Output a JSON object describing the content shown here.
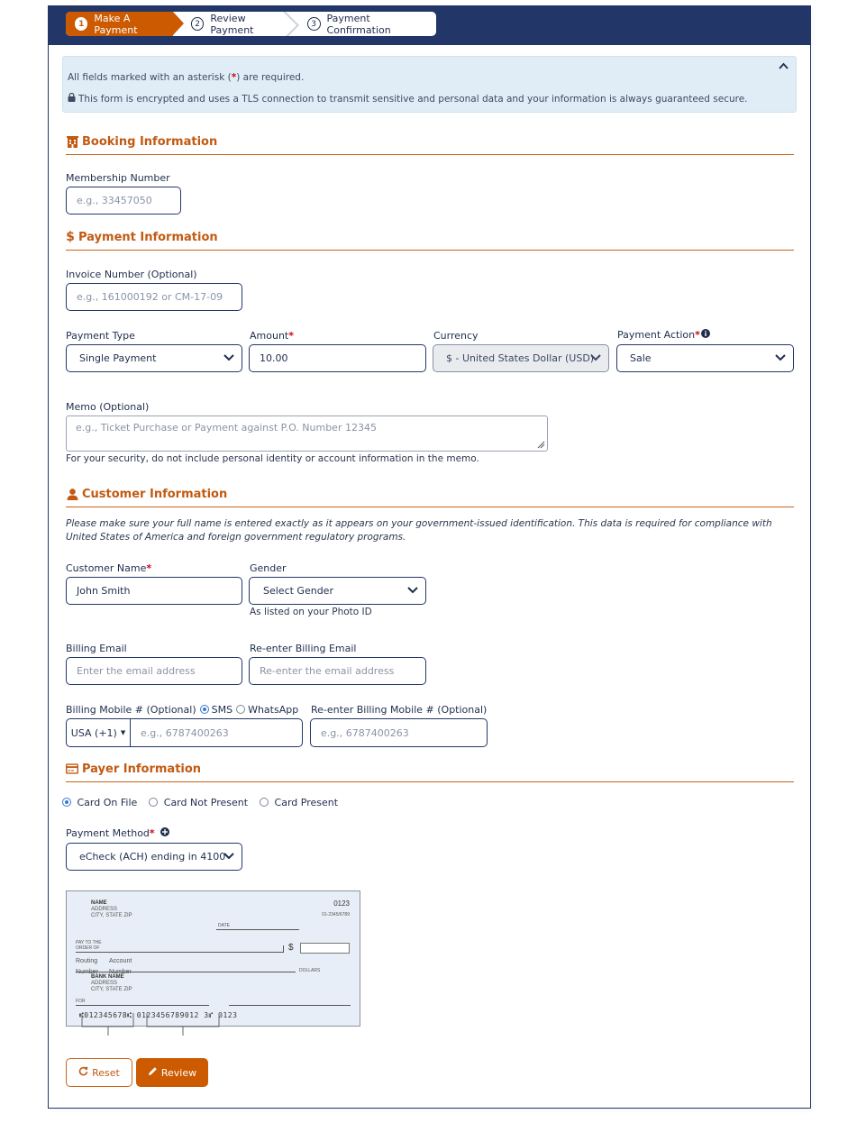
{
  "stepper": {
    "steps": [
      {
        "num": "1",
        "label": "Make A Payment",
        "active": true
      },
      {
        "num": "2",
        "label": "Review Payment",
        "active": false
      },
      {
        "num": "3",
        "label": "Payment Confirmation",
        "active": false
      }
    ]
  },
  "notice": {
    "required_prefix": "All fields marked with an asterisk (",
    "required_star": "*",
    "required_suffix": ") are required.",
    "security_text": "This form is encrypted and uses a TLS connection to transmit sensitive and personal data and your information is always guaranteed secure.",
    "collapse_icon": "chevron-up-icon"
  },
  "booking": {
    "title": "Booking Information",
    "icon": "building-icon",
    "membership_label": "Membership Number",
    "membership_placeholder": "e.g., 33457050"
  },
  "payment": {
    "title": "Payment Information",
    "icon": "dollar-icon",
    "invoice_label": "Invoice Number (Optional)",
    "invoice_placeholder": "e.g., 161000192 or CM-17-09",
    "payment_type_label": "Payment Type",
    "payment_type_value": "Single Payment",
    "amount_label": "Amount",
    "amount_value": "10.00",
    "currency_label": "Currency",
    "currency_value": "$ - United States Dollar (USD)",
    "action_label": "Payment Action",
    "action_value": "Sale",
    "memo_label": "Memo (Optional)",
    "memo_placeholder": "e.g., Ticket Purchase or Payment against P.O. Number 12345",
    "memo_help": "For your security, do not include personal identity or account information in the memo."
  },
  "customer": {
    "title": "Customer Information",
    "icon": "user-icon",
    "note": "Please make sure your full name is entered exactly as it appears on your government-issued identification. This data is required for compliance with United States of America and foreign government regulatory programs.",
    "name_label": "Customer Name",
    "name_value": "John Smith",
    "gender_label": "Gender",
    "gender_value": "Select Gender",
    "gender_help": "As listed on your Photo ID",
    "email_label": "Billing Email",
    "email_placeholder": "Enter the email address",
    "reemail_label": "Re-enter Billing Email",
    "reemail_placeholder": "Re-enter the email address",
    "mobile_label": "Billing Mobile # (Optional)",
    "sms_label": "SMS",
    "whatsapp_label": "WhatsApp",
    "country_code": "USA (+1)",
    "mobile_placeholder": "e.g., 6787400263",
    "remobile_label": "Re-enter Billing Mobile # (Optional)",
    "remobile_placeholder": "e.g., 6787400263"
  },
  "payer": {
    "title": "Payer Information",
    "icon": "credit-card-icon",
    "options": [
      {
        "label": "Card On File",
        "selected": true
      },
      {
        "label": "Card Not Present",
        "selected": false
      },
      {
        "label": "Card Present",
        "selected": false
      }
    ],
    "method_label": "Payment Method",
    "method_value": "eCheck (ACH) ending in 4100"
  },
  "check_image": {
    "name": "NAME",
    "address": "ADDRESS",
    "city": "CITY, STATE  ZIP",
    "check_no": "0123",
    "fraction": "01-2345/6789",
    "date": "DATE",
    "pay_to_1": "PAY TO THE",
    "pay_to_2": "ORDER OF",
    "dollar_sign": "$",
    "dollars": "DOLLARS",
    "routing_1": "Routing",
    "routing_2": "Number",
    "account_1": "Account",
    "account_2": "Number",
    "bank_name": "BANK NAME",
    "bank_address": "ADDRESS",
    "bank_city": "CITY, STATE  ZIP",
    "for": "FOR",
    "micr": "⑆012345678⑆  0123456789012 3⑈  0123"
  },
  "actions": {
    "reset_label": "Reset",
    "review_label": "Review"
  }
}
